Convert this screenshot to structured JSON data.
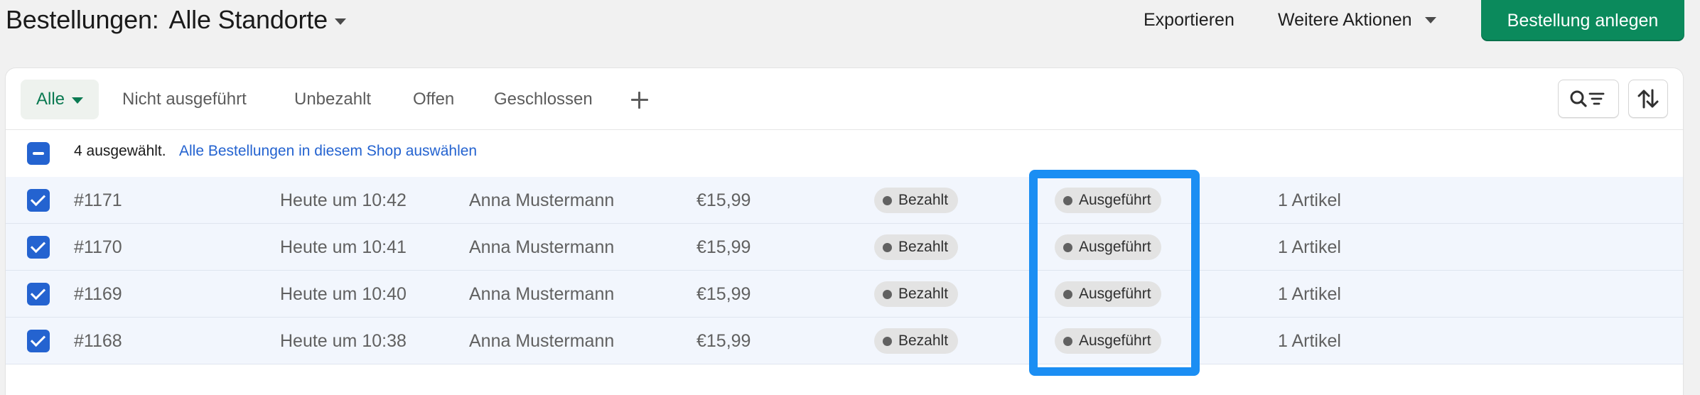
{
  "header": {
    "title": "Bestellungen:",
    "location": "Alle Standorte",
    "export_label": "Exportieren",
    "more_actions_label": "Weitere Aktionen",
    "create_order_label": "Bestellung anlegen"
  },
  "tabs": [
    {
      "label": "Alle",
      "active": true
    },
    {
      "label": "Nicht ausgeführt",
      "active": false
    },
    {
      "label": "Unbezahlt",
      "active": false
    },
    {
      "label": "Offen",
      "active": false
    },
    {
      "label": "Geschlossen",
      "active": false
    }
  ],
  "toolbar": {
    "add_view_icon": "plus-icon",
    "search_filter_icon": "search-filter-icon",
    "sort_icon": "sort-arrows-icon"
  },
  "selection": {
    "count_text": "4 ausgewählt.",
    "select_all_link": "Alle Bestellungen in diesem Shop auswählen"
  },
  "orders": [
    {
      "number": "#1171",
      "date": "Heute um 10:42",
      "customer": "Anna Mustermann",
      "total": "€15,99",
      "payment_status": "Bezahlt",
      "fulfillment_status": "Ausgeführt",
      "items": "1 Artikel",
      "selected": true
    },
    {
      "number": "#1170",
      "date": "Heute um 10:41",
      "customer": "Anna Mustermann",
      "total": "€15,99",
      "payment_status": "Bezahlt",
      "fulfillment_status": "Ausgeführt",
      "items": "1 Artikel",
      "selected": true
    },
    {
      "number": "#1169",
      "date": "Heute um 10:40",
      "customer": "Anna Mustermann",
      "total": "€15,99",
      "payment_status": "Bezahlt",
      "fulfillment_status": "Ausgeführt",
      "items": "1 Artikel",
      "selected": true
    },
    {
      "number": "#1168",
      "date": "Heute um 10:38",
      "customer": "Anna Mustermann",
      "total": "€15,99",
      "payment_status": "Bezahlt",
      "fulfillment_status": "Ausgeführt",
      "items": "1 Artikel",
      "selected": true
    }
  ],
  "colors": {
    "primary_button": "#0b8a5c",
    "checkbox": "#2463d0",
    "link": "#2463d0",
    "highlight": "#1b8ef3",
    "selected_row": "#f2f6fd"
  }
}
